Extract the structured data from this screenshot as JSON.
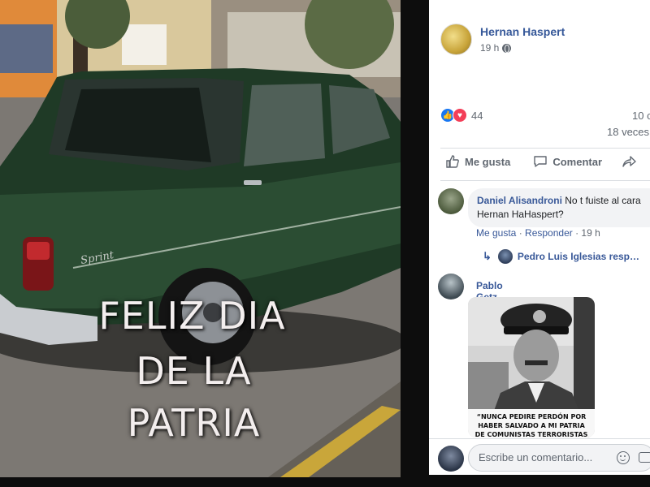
{
  "photo": {
    "overlay_line1": "FELIZ DIA",
    "overlay_line2": "DE LA",
    "overlay_line3": "PATRIA",
    "car_badge": "Sprint"
  },
  "post": {
    "author": "Hernan Haspert",
    "time": "19 h",
    "reaction_count": "44",
    "comments_count": "10 c",
    "shares_count": "18 veces",
    "actions": {
      "like": "Me gusta",
      "comment": "Comentar"
    }
  },
  "comments": [
    {
      "author": "Daniel Alisandroni",
      "text_line1": "No t fuiste al cara",
      "text_line2": "Hernan HaHaspert?",
      "like": "Me gusta",
      "reply": "Responder",
      "time": "19 h",
      "replies_summary": "Pedro Luis Iglesias resp…",
      "ellipsis": "·"
    },
    {
      "author": "Pablo Getz",
      "meme_caption_line1": "“NUNCA PEDIRE PERDÓN POR",
      "meme_caption_line2": "HABER SALVADO A MI PATRIA",
      "meme_caption_line3": "DE COMUNISTAS TERRORISTAS"
    }
  ],
  "composer": {
    "placeholder": "Escribe un comentario..."
  },
  "colors": {
    "link": "#365899",
    "like_blue": "#1877f2",
    "love_red": "#f33e58",
    "bubble": "#f2f3f5"
  }
}
